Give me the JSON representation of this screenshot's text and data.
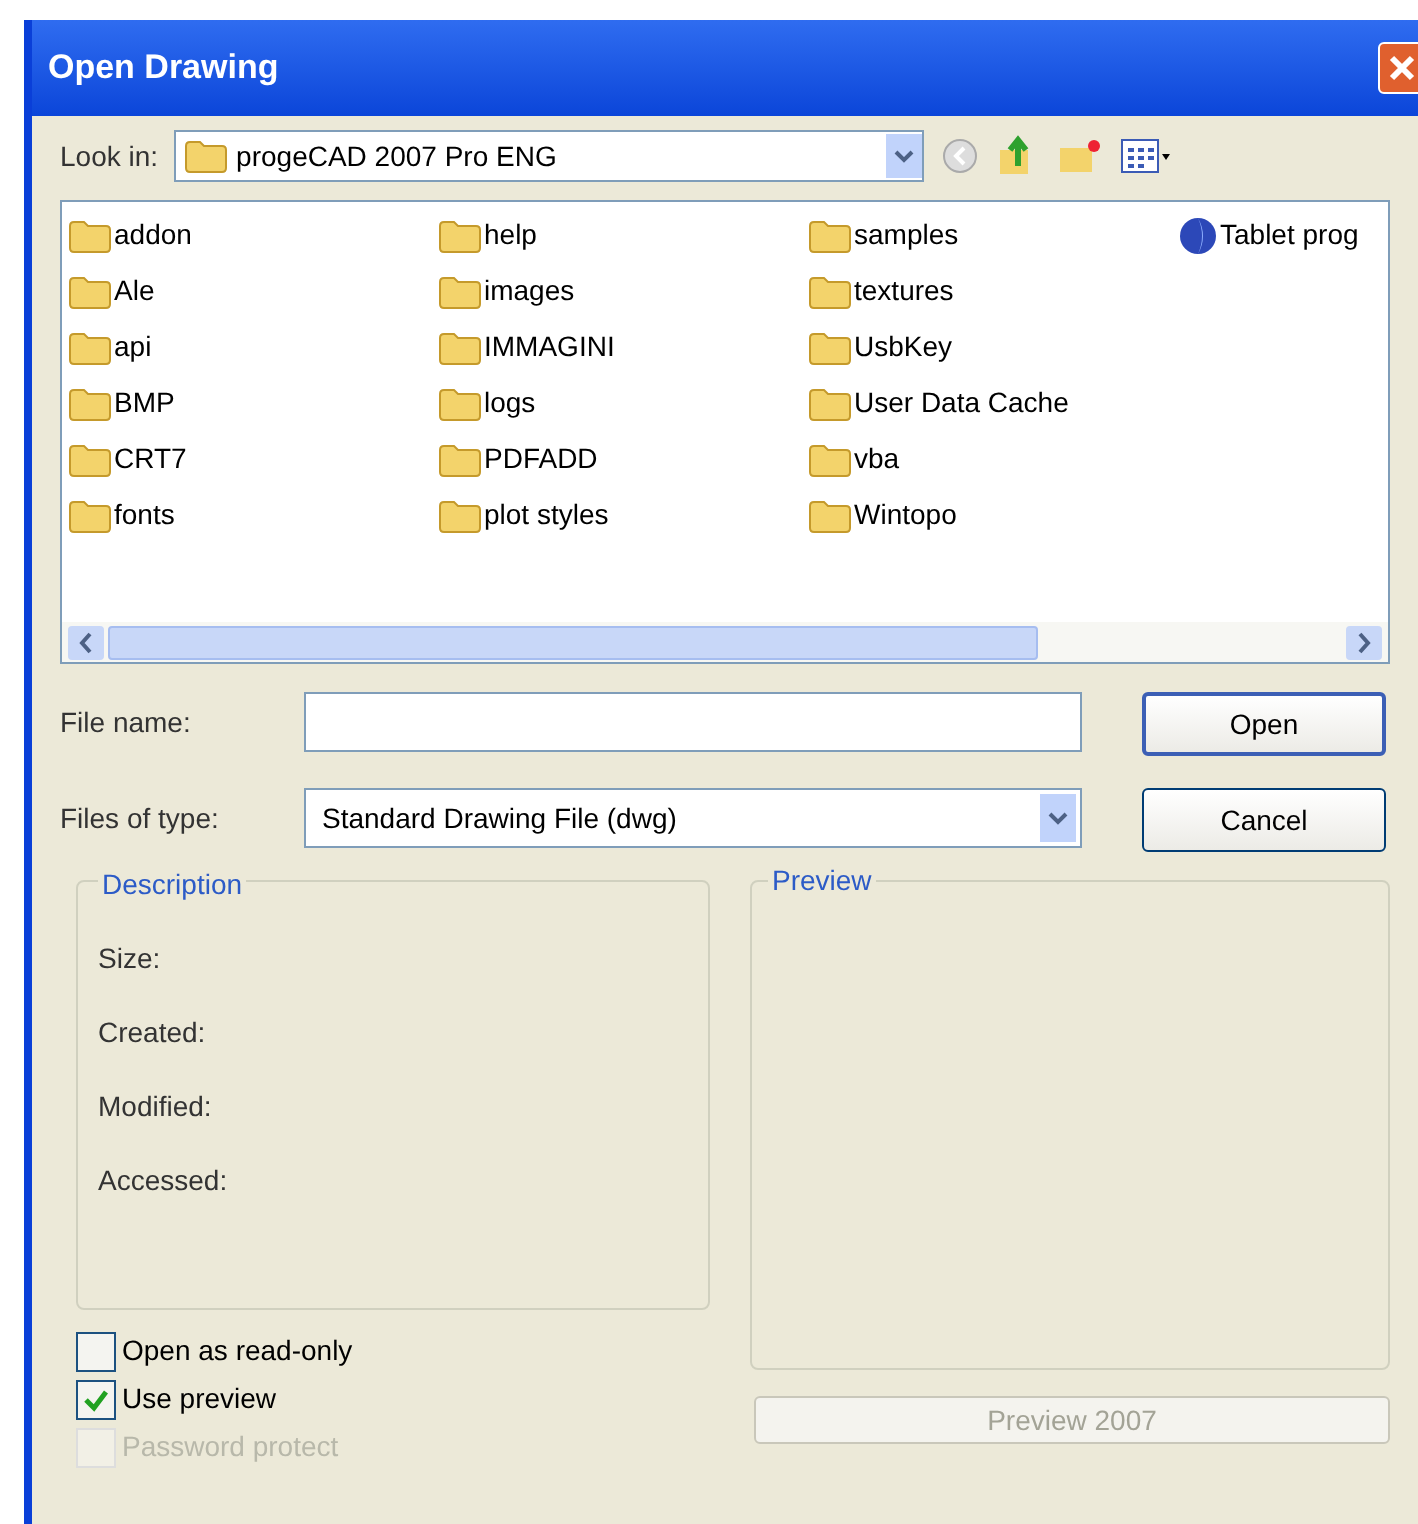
{
  "window": {
    "title": "Open Drawing"
  },
  "look_in": {
    "label": "Look in:",
    "value": "progeCAD 2007 Pro ENG"
  },
  "files": [
    [
      {
        "name": "addon",
        "kind": "folder"
      },
      {
        "name": "Ale",
        "kind": "folder"
      },
      {
        "name": "api",
        "kind": "folder"
      },
      {
        "name": "BMP",
        "kind": "folder"
      },
      {
        "name": "CRT7",
        "kind": "folder"
      },
      {
        "name": "fonts",
        "kind": "folder"
      }
    ],
    [
      {
        "name": "help",
        "kind": "folder"
      },
      {
        "name": "images",
        "kind": "folder"
      },
      {
        "name": "IMMAGINI",
        "kind": "folder"
      },
      {
        "name": "logs",
        "kind": "folder"
      },
      {
        "name": "PDFADD",
        "kind": "folder"
      },
      {
        "name": "plot styles",
        "kind": "folder"
      }
    ],
    [
      {
        "name": "samples",
        "kind": "folder"
      },
      {
        "name": "textures",
        "kind": "folder"
      },
      {
        "name": "UsbKey",
        "kind": "folder"
      },
      {
        "name": "User Data Cache",
        "kind": "folder"
      },
      {
        "name": "vba",
        "kind": "folder"
      },
      {
        "name": "Wintopo",
        "kind": "folder"
      }
    ],
    [
      {
        "name": "Tablet prog",
        "kind": "globe"
      }
    ]
  ],
  "file_name": {
    "label": "File name:"
  },
  "file_type": {
    "label": "Files of type:",
    "value": "Standard Drawing File (dwg)"
  },
  "buttons": [
    "Open",
    "Cancel"
  ],
  "description": {
    "title": "Description",
    "fields": [
      "Size:",
      "Created:",
      "Modified:",
      "Accessed:"
    ]
  },
  "preview": {
    "title": "Preview",
    "button": "Preview 2007"
  },
  "options": [
    {
      "label": "Open as read-only",
      "checked": false,
      "disabled": false
    },
    {
      "label": "Use preview",
      "checked": true,
      "disabled": false
    },
    {
      "label": "Password protect",
      "checked": false,
      "disabled": true
    }
  ]
}
